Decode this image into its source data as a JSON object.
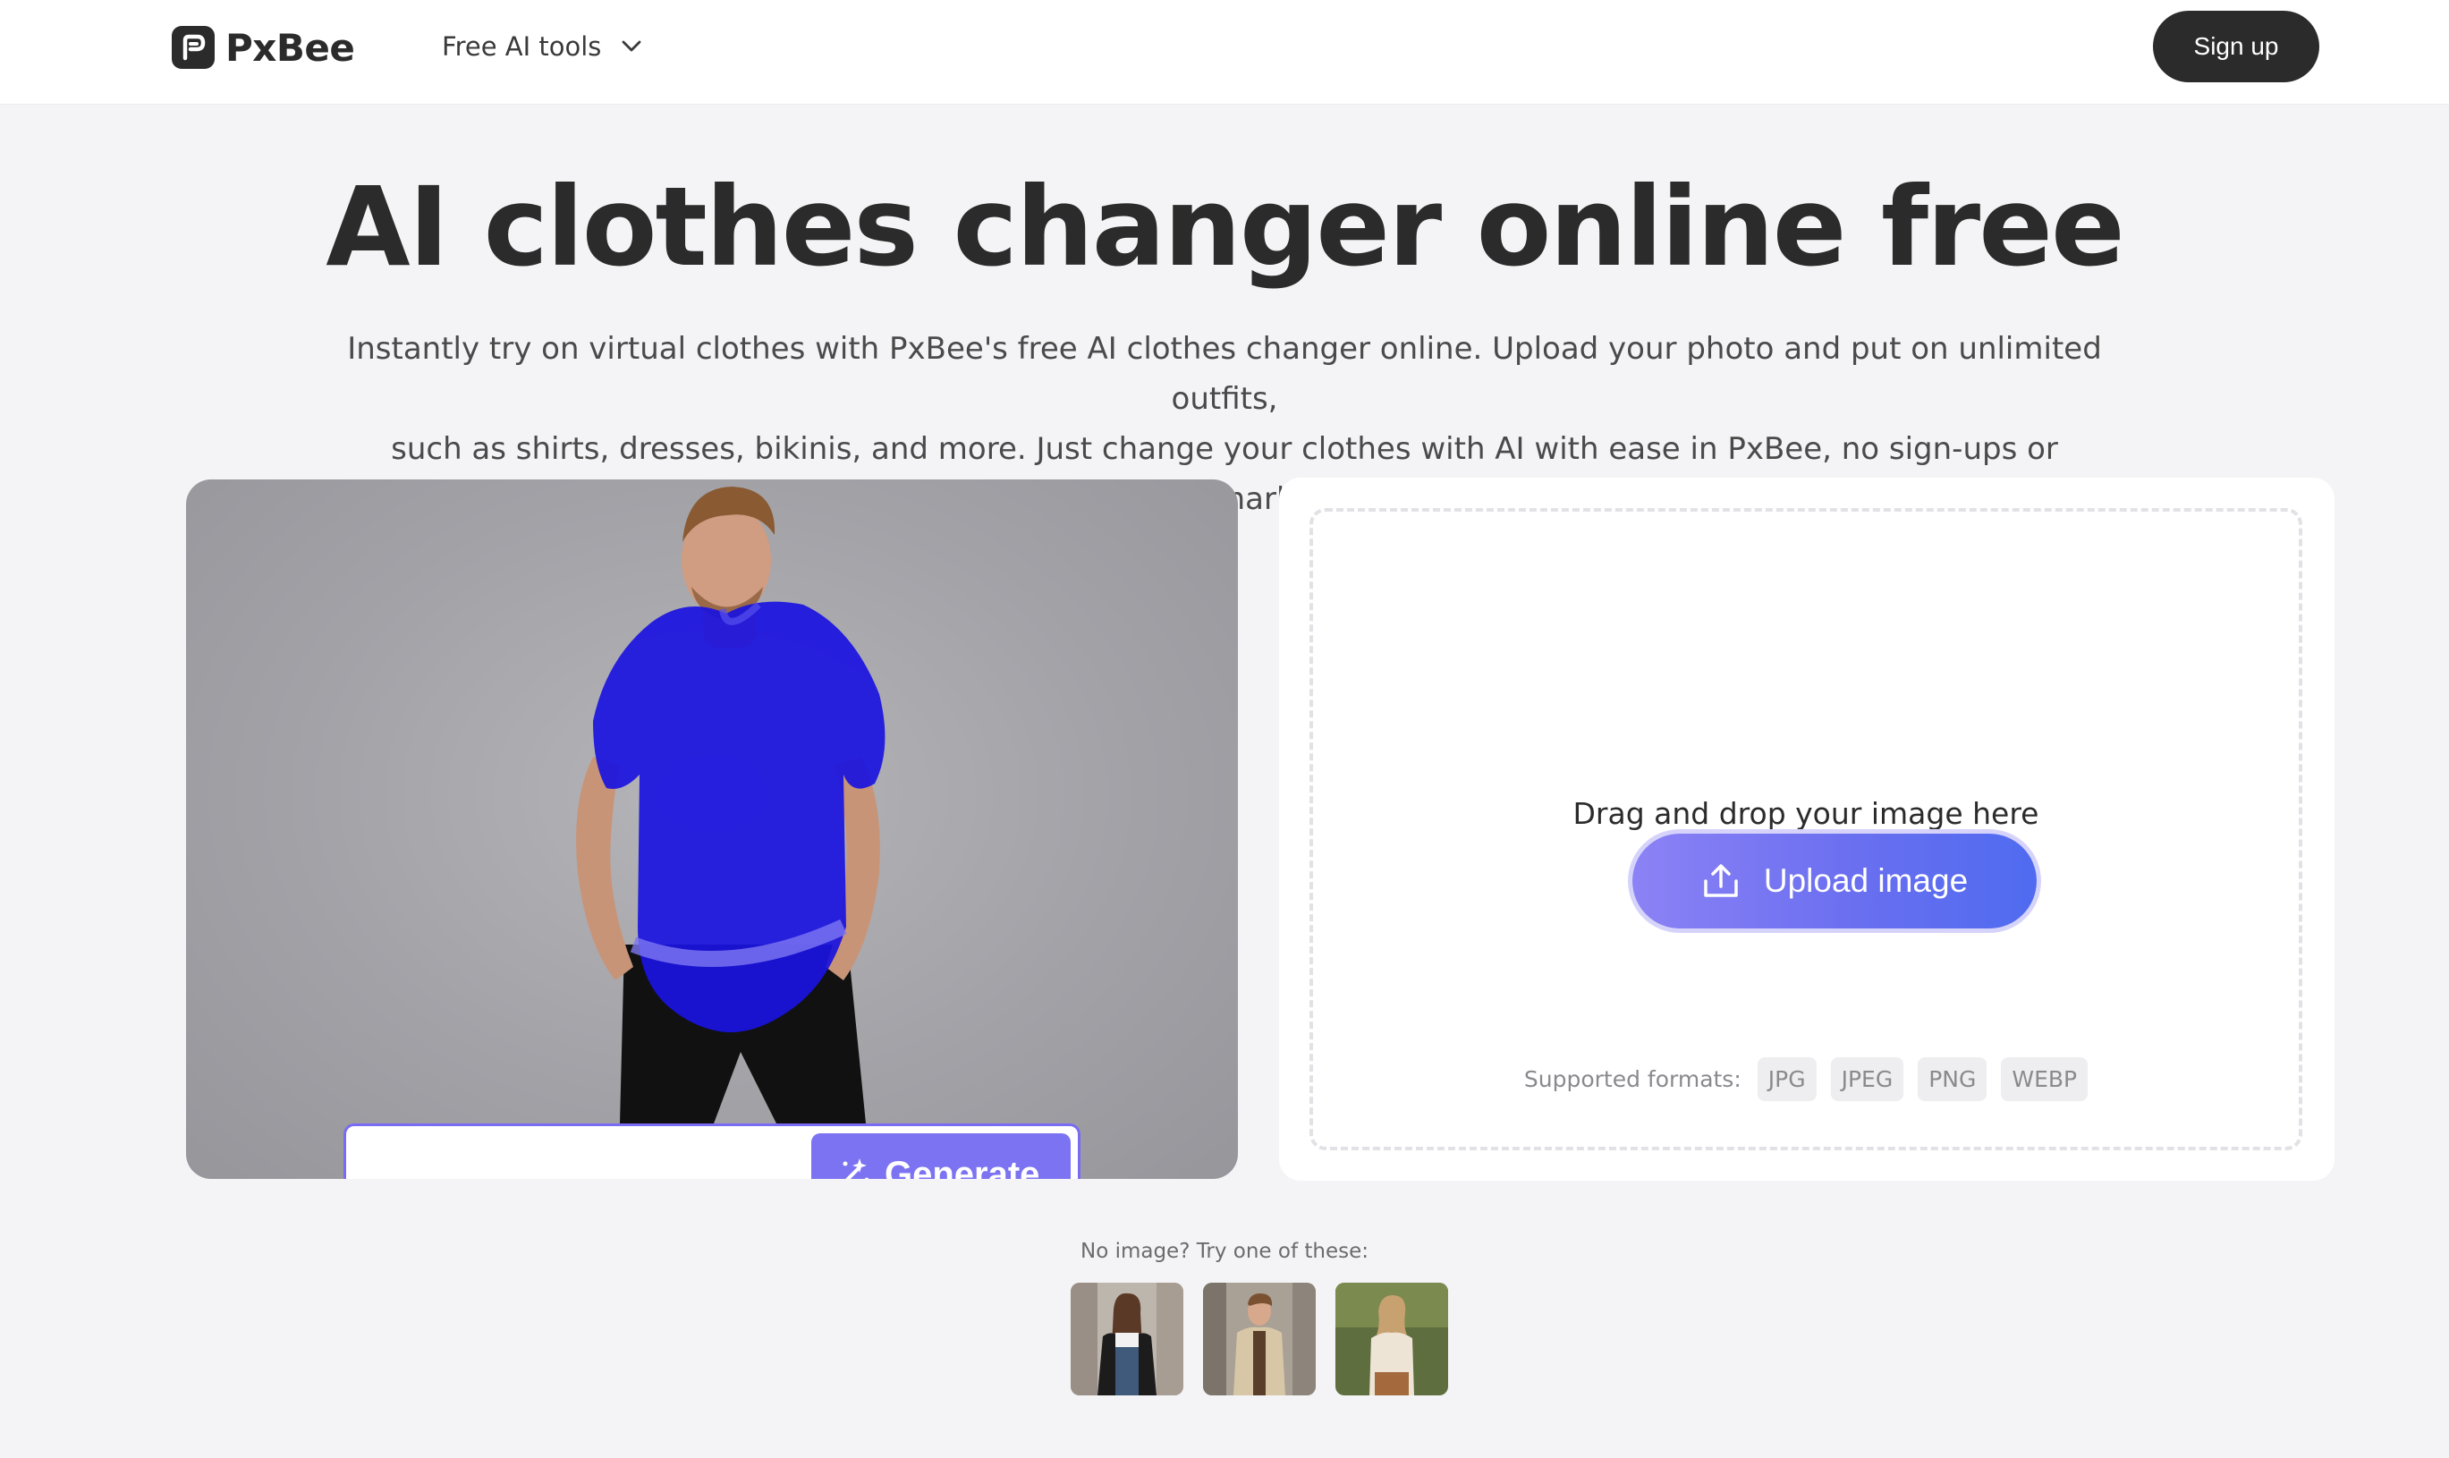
{
  "header": {
    "brand": "PxBee",
    "nav_label": "Free AI tools",
    "signup_label": "Sign up"
  },
  "hero": {
    "title": "AI clothes changer online free",
    "subtitle_line1": "Instantly try on virtual clothes with PxBee's free AI clothes changer online. Upload your photo and put on unlimited outfits,",
    "subtitle_line2": "such as shirts, dresses, bikinis, and more. Just change your clothes with AI with ease in PxBee, no sign-ups or watermarks."
  },
  "demo": {
    "generate_label": "Generate"
  },
  "upload": {
    "drag_text": "Drag and drop your image here",
    "button_label": "Upload image",
    "formats_label": "Supported formats:",
    "formats": [
      "JPG",
      "JPEG",
      "PNG",
      "WEBP"
    ]
  },
  "samples": {
    "label": "No image? Try one of these:",
    "items": [
      "woman-street-photo",
      "man-street-photo",
      "woman-field-photo"
    ]
  },
  "colors": {
    "brand_dark": "#2b2b2b",
    "accent": "#6a6ff0",
    "mask_blue": "#1a12e0"
  }
}
